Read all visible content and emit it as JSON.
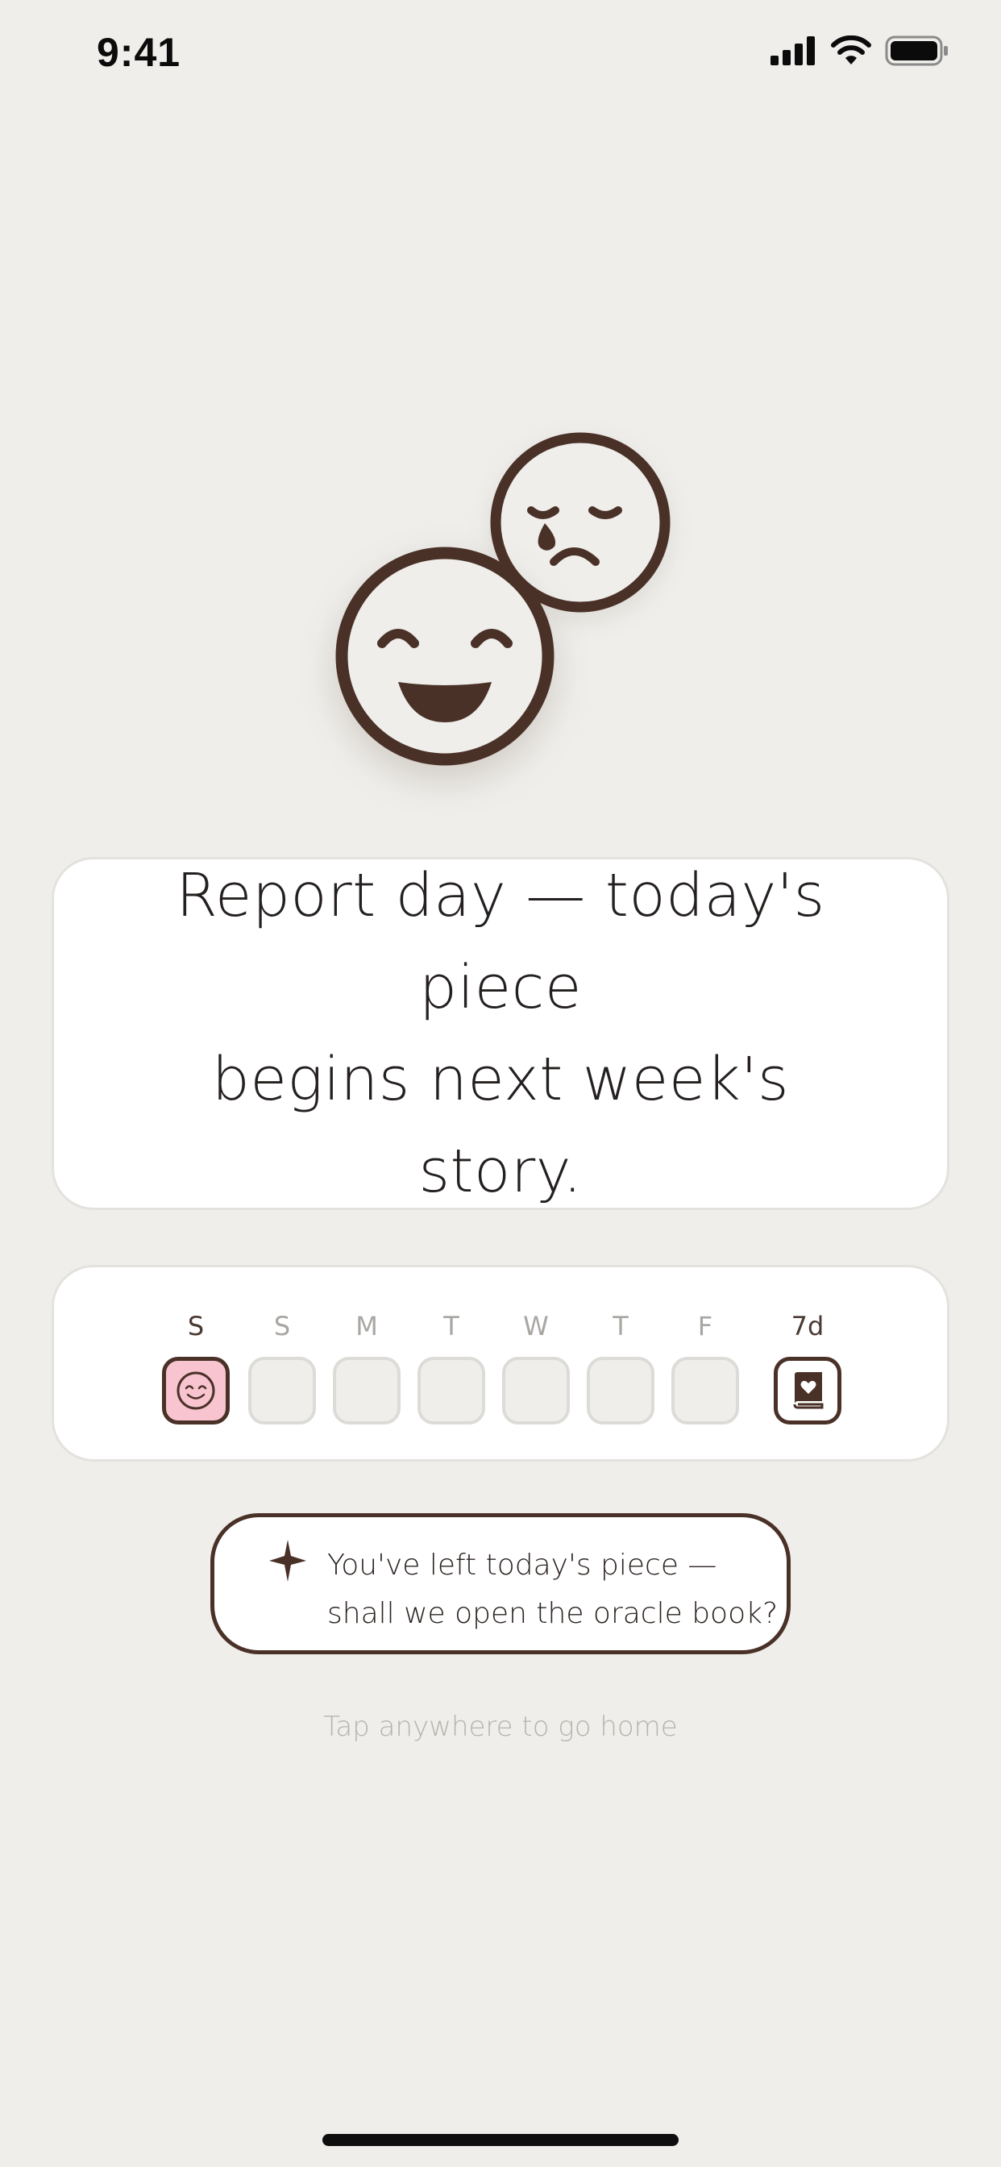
{
  "status_bar": {
    "time": "9:41",
    "icons": [
      "signal-icon",
      "wifi-icon",
      "battery-icon"
    ]
  },
  "illustration": {
    "icons": [
      "happy-face-icon",
      "crying-face-icon"
    ]
  },
  "message": {
    "line1": "Report day — today's",
    "line2": "piece",
    "line3": "begins next week's story."
  },
  "week": {
    "days": [
      {
        "label": "S",
        "state": "filled",
        "icon": "smiley-icon"
      },
      {
        "label": "S",
        "state": "empty"
      },
      {
        "label": "M",
        "state": "empty"
      },
      {
        "label": "T",
        "state": "empty"
      },
      {
        "label": "W",
        "state": "empty"
      },
      {
        "label": "T",
        "state": "empty"
      },
      {
        "label": "F",
        "state": "empty"
      },
      {
        "label": "7d",
        "state": "book",
        "icon": "heart-book-icon"
      }
    ]
  },
  "oracle": {
    "icon": "sparkle-star-icon",
    "line1": "You've left today's piece —",
    "line2": "shall we open the oracle book?"
  },
  "hint": "Tap anywhere to go home",
  "colors": {
    "background": "#efeeeb",
    "ink_brown": "#4a3128",
    "accent_pink": "#f7c4cf",
    "card": "#ffffff"
  }
}
